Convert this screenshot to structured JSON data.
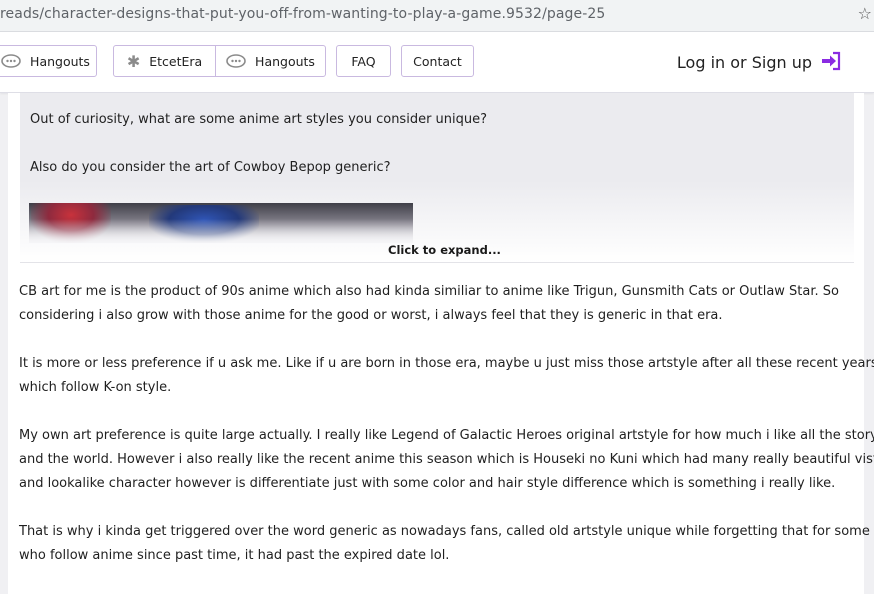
{
  "browser": {
    "url_fragment": "reads/character-designs-that-put-you-off-from-wanting-to-play-a-game.9532/page-25"
  },
  "nav": {
    "hangouts_1": "Hangouts",
    "etcetera": "EtcetEra",
    "hangouts_2": "Hangouts",
    "faq": "FAQ",
    "contact": "Contact",
    "login": "Log in or Sign up"
  },
  "quote": {
    "line1": "Out of curiosity, what are some anime art styles you consider unique?",
    "line2": "Also do you consider the art of Cowboy Bepop generic?",
    "expand": "Click to expand..."
  },
  "post": {
    "p1": [
      "CB art for me is the product of 90s anime which also had kinda similiar to anime like Trigun, Gunsmith Cats or Outlaw Star. So",
      "considering i also grow with those anime for the good or worst, i always feel that they is generic in that era."
    ],
    "p2": [
      "It is more or less preference if u ask me. Like if u are born in those era, maybe u just miss those artstyle after all these recent years arts",
      "which follow K-on style."
    ],
    "p3": [
      "My own art preference is quite large actually. I really like Legend of Galactic Heroes original artstyle for how much i like all the story",
      "and the world. However i also really like the recent anime this season which is Houseki no Kuni which had many really beautiful vista",
      "and lookalike character however is differentiate just with some color and hair style difference which is something i really like."
    ],
    "p4": [
      "That is why i kinda get triggered over the word generic as nowadays fans, called old artstyle unique while forgetting that for some of us",
      "who follow anime since past time, it had past the expired date lol."
    ]
  },
  "colors": {
    "accent": "#8a2be2",
    "button_border": "#c9b9e0",
    "quote_bg": "#ebebef"
  },
  "icons": {
    "hangouts": "speech-bubble-icon",
    "etcetera": "asterisk-icon",
    "login": "sign-in-icon"
  }
}
